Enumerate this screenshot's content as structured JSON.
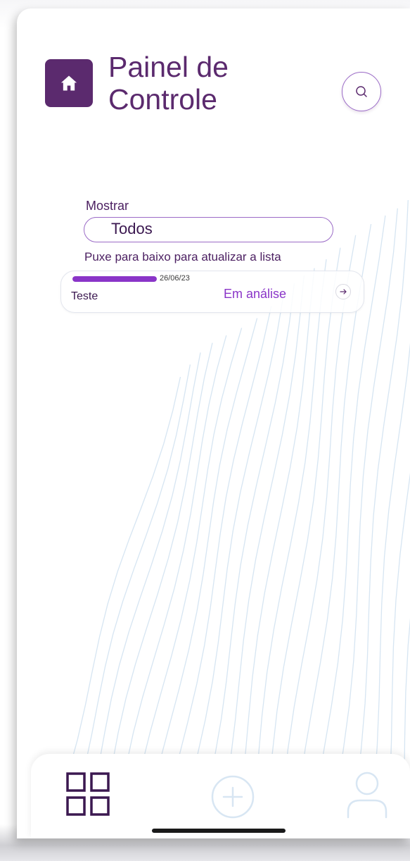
{
  "header": {
    "title": "Painel de Controle",
    "home_icon": "home-icon",
    "search_icon": "search-icon"
  },
  "filter": {
    "label": "Mostrar",
    "selected": "Todos"
  },
  "hint": "Puxe para baixo para atualizar a lista",
  "items": [
    {
      "title": "Teste",
      "date": "26/06/23",
      "status": "Em análise",
      "progress": 1.0
    }
  ],
  "bottom_nav": {
    "items": [
      {
        "name": "dashboard",
        "icon": "grid-icon",
        "active": true
      },
      {
        "name": "add",
        "icon": "plus-icon",
        "active": false
      },
      {
        "name": "profile",
        "icon": "user-icon",
        "active": false
      }
    ]
  },
  "colors": {
    "primary": "#5b2a6e",
    "accent": "#8a35c8",
    "muted_icon": "#d8e6f3"
  }
}
